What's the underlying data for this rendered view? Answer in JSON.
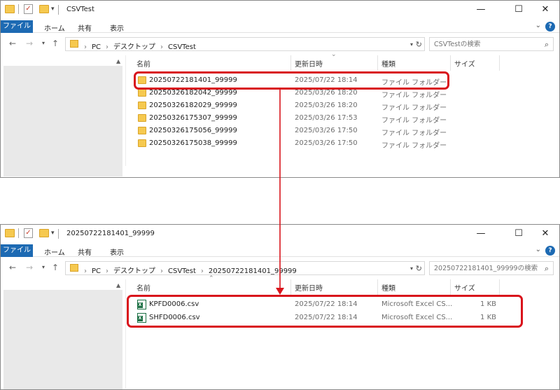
{
  "window1": {
    "title": "CSVTest",
    "menu": [
      "ファイル",
      "ホーム",
      "共有",
      "表示"
    ],
    "address": [
      "PC",
      "デスクトップ",
      "CSVTest"
    ],
    "search_placeholder": "CSVTestの検索",
    "columns": {
      "name": "名前",
      "date": "更新日時",
      "type": "種類",
      "size": "サイズ"
    },
    "rows": [
      {
        "name": "20250722181401_99999",
        "date": "2025/07/22 18:14",
        "type": "ファイル フォルダー",
        "size": ""
      },
      {
        "name": "20250326182042_99999",
        "date": "2025/03/26 18:20",
        "type": "ファイル フォルダー",
        "size": ""
      },
      {
        "name": "20250326182029_99999",
        "date": "2025/03/26 18:20",
        "type": "ファイル フォルダー",
        "size": ""
      },
      {
        "name": "20250326175307_99999",
        "date": "2025/03/26 17:53",
        "type": "ファイル フォルダー",
        "size": ""
      },
      {
        "name": "20250326175056_99999",
        "date": "2025/03/26 17:50",
        "type": "ファイル フォルダー",
        "size": ""
      },
      {
        "name": "20250326175038_99999",
        "date": "2025/03/26 17:50",
        "type": "ファイル フォルダー",
        "size": ""
      }
    ]
  },
  "window2": {
    "title": "20250722181401_99999",
    "menu": [
      "ファイル",
      "ホーム",
      "共有",
      "表示"
    ],
    "address": [
      "PC",
      "デスクトップ",
      "CSVTest",
      "20250722181401_99999"
    ],
    "search_placeholder": "20250722181401_99999の検索",
    "columns": {
      "name": "名前",
      "date": "更新日時",
      "type": "種類",
      "size": "サイズ"
    },
    "rows": [
      {
        "name": "KPFD0006.csv",
        "date": "2025/07/22 18:14",
        "type": "Microsoft Excel CS...",
        "size": "1 KB"
      },
      {
        "name": "SHFD0006.csv",
        "date": "2025/07/22 18:14",
        "type": "Microsoft Excel CS...",
        "size": "1 KB"
      }
    ]
  },
  "icons": {
    "back": "back-arrow-icon",
    "forward": "forward-arrow-icon",
    "recent": "recent-locations-icon",
    "up": "up-arrow-icon",
    "refresh": "refresh-icon",
    "search": "search-icon",
    "folder": "folder-icon",
    "excel": "excel-csv-icon",
    "minimize": "minimize-icon",
    "maximize": "maximize-icon",
    "close": "close-icon",
    "help": "help-icon"
  },
  "colors": {
    "accent": "#1d6ab3",
    "highlight": "#d9141c",
    "folder": "#f6c94f",
    "excel": "#1e7145"
  }
}
